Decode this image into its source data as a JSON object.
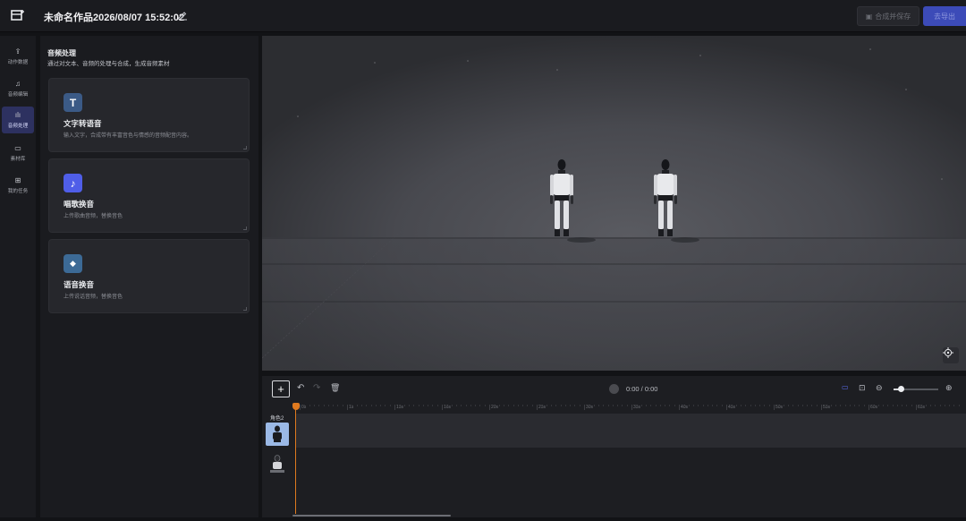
{
  "header": {
    "title": "未命名作品2026/08/07 15:52:02",
    "save_label": "合成并保存",
    "export_label": "去导出"
  },
  "rail": {
    "items": [
      {
        "label": "动作数据",
        "icon": "upload-icon",
        "active": false
      },
      {
        "label": "音频编辑",
        "icon": "music-note-icon",
        "active": false
      },
      {
        "label": "音频处理",
        "icon": "waveform-icon",
        "active": true
      },
      {
        "label": "素材库",
        "icon": "library-icon",
        "active": false
      },
      {
        "label": "我的任务",
        "icon": "task-icon",
        "active": false
      }
    ]
  },
  "panel": {
    "title": "音频处理",
    "subtitle": "通过对文本、音频的处理与合成，生成音频素材",
    "cards": [
      {
        "title": "文字转语音",
        "desc": "输入文字，合成带有丰富音色与情感的音频配音内容。",
        "icon": "text-icon",
        "icon_color": "#3b5a86",
        "glyph": "T"
      },
      {
        "title": "唱歌换音",
        "desc": "上传歌曲音频，替换音色",
        "icon": "music-icon",
        "icon_color": "#4f5ee8",
        "glyph": "♪"
      },
      {
        "title": "语音换音",
        "desc": "上传说话音频，替换音色",
        "icon": "voice-change-icon",
        "icon_color": "#3c6a96",
        "glyph": "◆"
      }
    ]
  },
  "timeline": {
    "time": "0:00 / 0:00",
    "role_label": "角色2",
    "ticks": [
      "0s",
      "1s",
      "15s",
      "16s",
      "20s",
      "25s",
      "30s",
      "35s",
      "40s",
      "45s",
      "50s",
      "55s",
      "60s",
      "65s"
    ],
    "zoom_level": 0.15
  },
  "colors": {
    "accent": "#3c4bb8",
    "playhead": "#e07a1f",
    "active_rail": "#2d3160"
  }
}
